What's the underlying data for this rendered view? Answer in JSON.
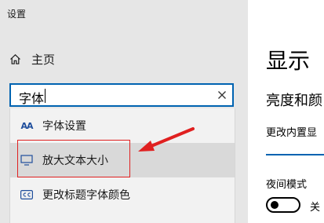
{
  "window": {
    "title": "设置"
  },
  "sidebar": {
    "home_label": "主页"
  },
  "search": {
    "value": "字体",
    "suggestions": [
      {
        "label": "字体设置",
        "icon": "font-aa-icon"
      },
      {
        "label": "放大文本大小",
        "icon": "monitor-icon"
      },
      {
        "label": "更改标题字体颜色",
        "icon": "cc-caption-icon"
      }
    ]
  },
  "main": {
    "title": "显示",
    "section": "亮度和颜",
    "sub_text": "更改内置显",
    "night_mode_label": "夜间模式",
    "night_mode_state": "关"
  },
  "colors": {
    "accent": "#0063b1",
    "annotation": "#e02020"
  }
}
